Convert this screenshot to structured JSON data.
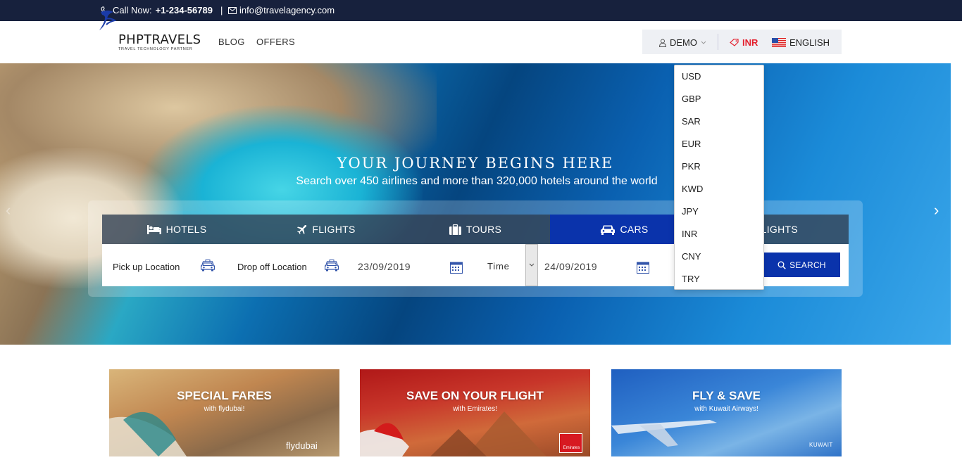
{
  "topbar": {
    "call_label": "Call Now:",
    "phone": "+1-234-56789",
    "separator": "|",
    "email": "info@travelagency.com"
  },
  "brand": {
    "name": "PHPTRAVELS",
    "tagline": "TRAVEL TECHNOLOGY PARTNER"
  },
  "nav": {
    "links": [
      "BLOG",
      "OFFERS"
    ]
  },
  "navtools": {
    "account": "DEMO",
    "currency": "INR",
    "language": "ENGLISH"
  },
  "hero": {
    "title": "YOUR JOURNEY BEGINS HERE",
    "subtitle": "Search over 450 airlines and more than 320,000 hotels around the world"
  },
  "tabs": [
    "HOTELS",
    "FLIGHTS",
    "TOURS",
    "CARS",
    "LIGHTS"
  ],
  "active_tab": "CARS",
  "form": {
    "pickup_label": "Pick up Location",
    "dropoff_label": "Drop off Location",
    "pickup_date": "23/09/2019",
    "time_label": "Time",
    "dropoff_date": "24/09/2019",
    "search_label": "SEARCH"
  },
  "currency_options": [
    "USD",
    "GBP",
    "SAR",
    "EUR",
    "PKR",
    "KWD",
    "JPY",
    "INR",
    "CNY",
    "TRY"
  ],
  "offers": [
    {
      "title": "SPECIAL FARES",
      "subtitle": "with flydubai!",
      "brand": "flydubai"
    },
    {
      "title": "SAVE ON YOUR FLIGHT",
      "subtitle": "with Emirates!",
      "brand": "Emirates"
    },
    {
      "title": "FLY & SAVE",
      "subtitle": "with Kuwait Airways!",
      "brand": "KUWAIT"
    }
  ],
  "colors": {
    "topbar": "#17213d",
    "accent": "#0a33ab",
    "currency": "#e41f2d"
  }
}
